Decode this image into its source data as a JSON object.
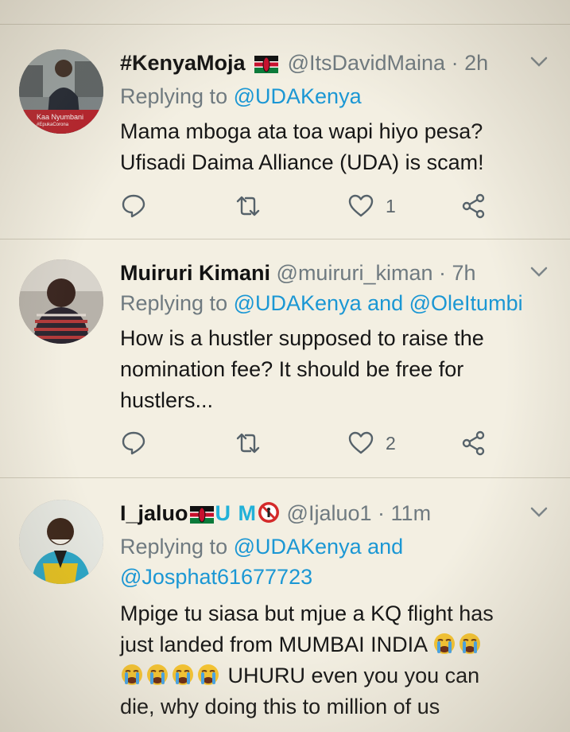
{
  "tweets": [
    {
      "display_name": "#KenyaMoja",
      "handle": "@ItsDavidMaina",
      "time": "· 2h",
      "replying_prefix": "Replying to",
      "replying_to": "@UDAKenya",
      "replying_line2": "",
      "text": [
        "Mama mboga ata toa wapi hiyo pesa?",
        "Ufisadi Daima Alliance (UDA) is scam!"
      ],
      "likes": "1",
      "avatar_caption": "Kaa Nyumbani",
      "avatar_caption2": "#EpukaCorona"
    },
    {
      "display_name": "Muiruri Kimani",
      "handle": "@muiruri_kiman",
      "time": "· 7h",
      "replying_prefix": "Replying to",
      "replying_to": "@UDAKenya and @OleItumbi",
      "replying_line2": "",
      "text": [
        "How is a hustler supposed to raise the",
        "nomination fee? It should be free for",
        "hustlers..."
      ],
      "likes": "2"
    },
    {
      "display_name": "I_jaluo",
      "name_suffix": "U M",
      "handle": "@Ijaluo1",
      "time": "· 11m",
      "replying_prefix": "Replying to",
      "replying_to": "@UDAKenya and",
      "replying_line2": "@Josphat61677723",
      "text_line1": "Mpige tu siasa but mjue a KQ flight has",
      "text_line2": "just landed from MUMBAI INDIA",
      "text_line3": "UHURU even you you can",
      "text_line4": "die, why doing this to million of us"
    }
  ],
  "colors": {
    "background": "#f3efe2",
    "link": "#1b97d4",
    "muted": "#6f7a80",
    "text": "#161616"
  },
  "icons": [
    "reply-icon",
    "retweet-icon",
    "like-icon",
    "share-icon",
    "chevron-down-icon",
    "kenya-flag-icon",
    "crying-face-icon",
    "no-entry-icon"
  ]
}
